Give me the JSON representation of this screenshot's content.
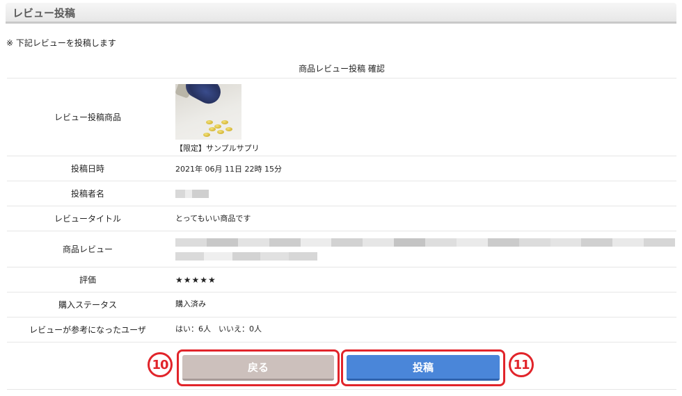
{
  "header": {
    "title": "レビュー投稿"
  },
  "notice": "※ 下記レビューを投稿します",
  "table": {
    "caption": "商品レビュー投稿 確認",
    "rows": [
      {
        "label": "レビュー投稿商品",
        "value": "【限定】サンプルサプリ"
      },
      {
        "label": "投稿日時",
        "value": "2021年 06月 11日 22時 15分"
      },
      {
        "label": "投稿者名",
        "value": ""
      },
      {
        "label": "レビュータイトル",
        "value": "とってもいい商品です"
      },
      {
        "label": "商品レビュー",
        "value": ""
      },
      {
        "label": "評価",
        "value": "★★★★★"
      },
      {
        "label": "購入ステータス",
        "value": "購入済み"
      },
      {
        "label": "レビューが参考になったユーザ",
        "value": "はい：6人　いいえ：0人"
      }
    ]
  },
  "buttons": {
    "back_label": "戻る",
    "post_label": "投稿"
  },
  "annotations": {
    "back_number": "10",
    "post_number": "11"
  },
  "colors": {
    "accent_red": "#e1242a",
    "post_blue": "#4a86d9",
    "back_gray": "#ccc0bc"
  }
}
